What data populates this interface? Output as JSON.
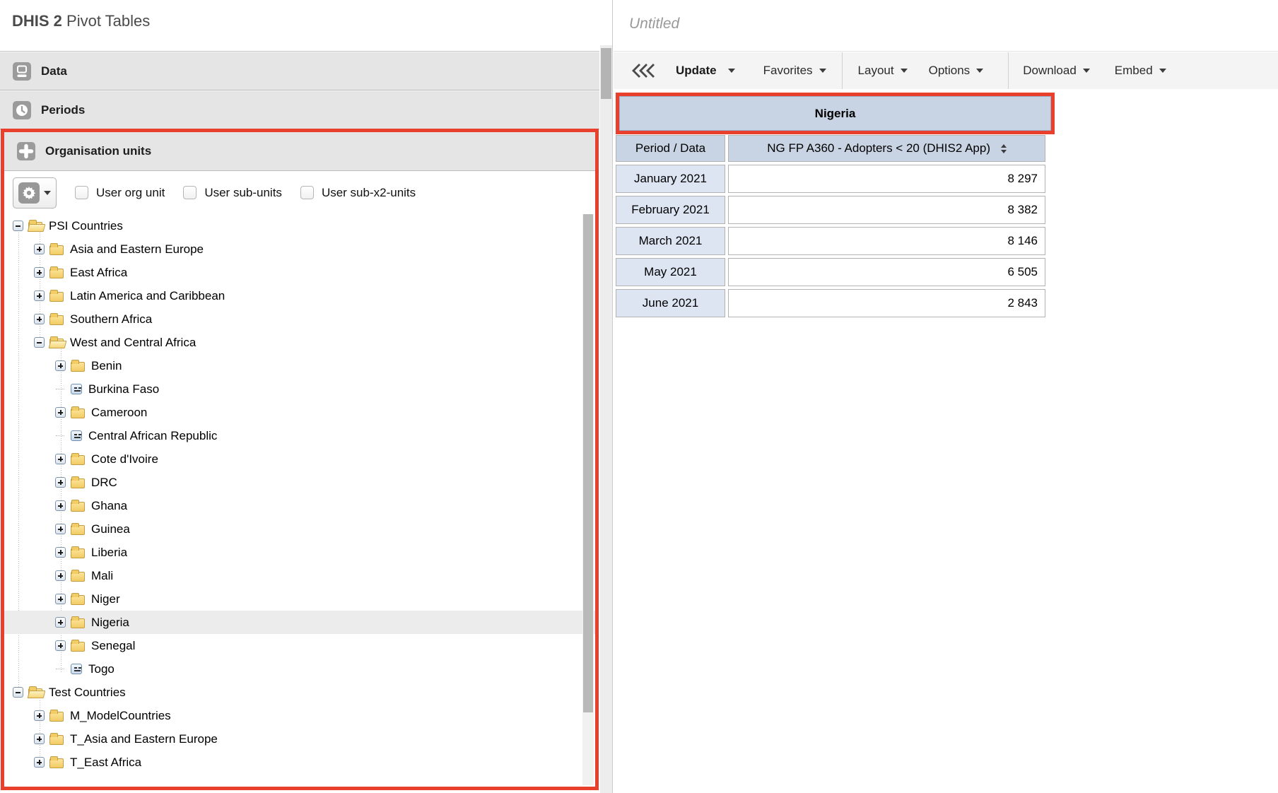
{
  "app": {
    "brand": "DHIS 2",
    "title": "Pivot Tables"
  },
  "accordion": {
    "sections": [
      {
        "label": "Data"
      },
      {
        "label": "Periods"
      },
      {
        "label": "Organisation units"
      }
    ]
  },
  "orgunit_panel": {
    "checkboxes": [
      {
        "label": "User org unit",
        "checked": false
      },
      {
        "label": "User sub-units",
        "checked": false
      },
      {
        "label": "User sub-x2-units",
        "checked": false
      }
    ]
  },
  "tree": {
    "items": [
      {
        "label": "PSI Countries",
        "depth": 0,
        "state": "expanded",
        "type": "folder-open",
        "selected": false
      },
      {
        "label": "Asia and Eastern Europe",
        "depth": 1,
        "state": "collapsed",
        "type": "folder",
        "selected": false
      },
      {
        "label": "East Africa",
        "depth": 1,
        "state": "collapsed",
        "type": "folder",
        "selected": false
      },
      {
        "label": "Latin America and Caribbean",
        "depth": 1,
        "state": "collapsed",
        "type": "folder",
        "selected": false
      },
      {
        "label": "Southern Africa",
        "depth": 1,
        "state": "collapsed",
        "type": "folder",
        "selected": false
      },
      {
        "label": "West and Central Africa",
        "depth": 1,
        "state": "expanded",
        "type": "folder-open",
        "selected": false
      },
      {
        "label": "Benin",
        "depth": 2,
        "state": "collapsed",
        "type": "folder",
        "selected": false
      },
      {
        "label": "Burkina Faso",
        "depth": 2,
        "state": "leaf",
        "type": "leaf",
        "selected": false
      },
      {
        "label": "Cameroon",
        "depth": 2,
        "state": "collapsed",
        "type": "folder",
        "selected": false
      },
      {
        "label": "Central African Republic",
        "depth": 2,
        "state": "leaf",
        "type": "leaf",
        "selected": false
      },
      {
        "label": "Cote d'Ivoire",
        "depth": 2,
        "state": "collapsed",
        "type": "folder",
        "selected": false
      },
      {
        "label": "DRC",
        "depth": 2,
        "state": "collapsed",
        "type": "folder",
        "selected": false
      },
      {
        "label": "Ghana",
        "depth": 2,
        "state": "collapsed",
        "type": "folder",
        "selected": false
      },
      {
        "label": "Guinea",
        "depth": 2,
        "state": "collapsed",
        "type": "folder",
        "selected": false
      },
      {
        "label": "Liberia",
        "depth": 2,
        "state": "collapsed",
        "type": "folder",
        "selected": false
      },
      {
        "label": "Mali",
        "depth": 2,
        "state": "collapsed",
        "type": "folder",
        "selected": false
      },
      {
        "label": "Niger",
        "depth": 2,
        "state": "collapsed",
        "type": "folder",
        "selected": false
      },
      {
        "label": "Nigeria",
        "depth": 2,
        "state": "collapsed",
        "type": "folder",
        "selected": true
      },
      {
        "label": "Senegal",
        "depth": 2,
        "state": "collapsed",
        "type": "folder",
        "selected": false
      },
      {
        "label": "Togo",
        "depth": 2,
        "state": "leaf",
        "type": "leaf",
        "selected": false
      },
      {
        "label": "Test Countries",
        "depth": 0,
        "state": "expanded",
        "type": "folder-open",
        "selected": false
      },
      {
        "label": "M_ModelCountries",
        "depth": 1,
        "state": "collapsed",
        "type": "folder",
        "selected": false
      },
      {
        "label": "T_Asia and Eastern Europe",
        "depth": 1,
        "state": "collapsed",
        "type": "folder",
        "selected": false
      },
      {
        "label": "T_East Africa",
        "depth": 1,
        "state": "collapsed",
        "type": "folder",
        "selected": false
      }
    ]
  },
  "right": {
    "title": "Untitled",
    "toolbar": {
      "update": "Update",
      "favorites": "Favorites",
      "layout": "Layout",
      "options": "Options",
      "download": "Download",
      "embed": "Embed"
    },
    "pivot": {
      "corner": "Nigeria",
      "row_dim": "Period / Data",
      "column": "NG FP A360 - Adopters < 20 (DHIS2 App)",
      "rows": [
        [
          "January 2021",
          "8 297"
        ],
        [
          "February 2021",
          "8 382"
        ],
        [
          "March 2021",
          "8 146"
        ],
        [
          "May 2021",
          "6 505"
        ],
        [
          "June 2021",
          "2 843"
        ]
      ]
    }
  },
  "colors": {
    "accent_red": "#e8402c",
    "table_header_blue": "#c8d4e3",
    "table_period_blue": "#dde5f3",
    "accordion_gray": "#e5e5e5"
  }
}
